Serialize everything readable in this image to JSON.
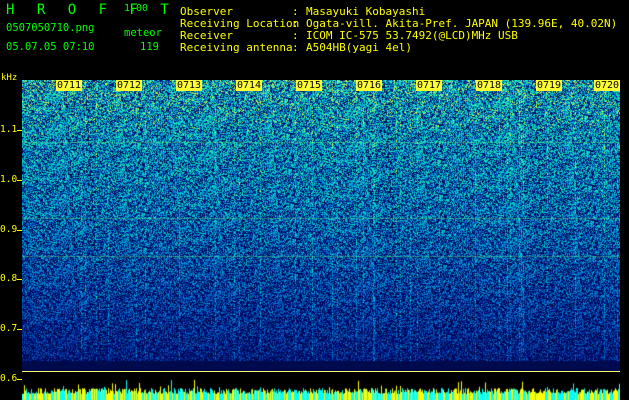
{
  "app": {
    "name": "H R O F F T",
    "version": "1.00"
  },
  "file": {
    "name": "0507050710.png",
    "datetime": "05.07.05 07:10",
    "meteor_label": "meteor",
    "meteor_count": "119"
  },
  "info": [
    {
      "label": "Observer",
      "value": "Masayuki Kobayashi"
    },
    {
      "label": "Receiving Location",
      "value": "Ogata-vill. Akita-Pref. JAPAN (139.96E, 40.02N)"
    },
    {
      "label": "Receiver",
      "value": "ICOM IC-575 53.7492(@LCD)MHz USB"
    },
    {
      "label": "Receiving antenna",
      "value": "A504HB(yagi 4el)"
    }
  ],
  "axis": {
    "unit": "kHz",
    "freq_labels": [
      "1.1",
      "1.0",
      "0.9",
      "0.8",
      "0.7",
      "0.6"
    ],
    "time_labels": [
      "0711",
      "0712",
      "0713",
      "0714",
      "0715",
      "0716",
      "0717",
      "0718",
      "0719",
      "0720"
    ]
  },
  "colors": {
    "header_text": "#ffff00",
    "app_text": "#00ff00",
    "background": "#000000",
    "spectrum_low": "#0a1a8c",
    "spectrum_high": "#00ffcc"
  }
}
